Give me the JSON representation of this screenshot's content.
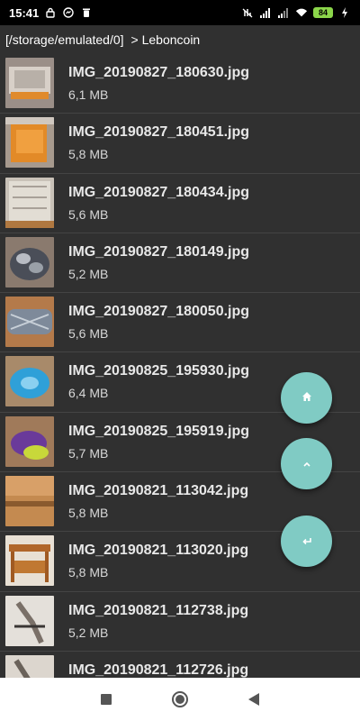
{
  "status_bar": {
    "time": "15:41",
    "battery": "84",
    "icons": [
      "lock-icon",
      "messenger-icon",
      "trash-icon",
      "data-off-icon",
      "signal-icon",
      "signal-icon",
      "wifi-icon",
      "battery-icon",
      "charging-icon"
    ]
  },
  "path": {
    "root": "[/storage/emulated/0]",
    "current": "> Leboncoin"
  },
  "files": [
    {
      "name": "IMG_20190827_180630.jpg",
      "size": "6,1 MB"
    },
    {
      "name": "IMG_20190827_180451.jpg",
      "size": "5,8 MB"
    },
    {
      "name": "IMG_20190827_180434.jpg",
      "size": "5,6 MB"
    },
    {
      "name": "IMG_20190827_180149.jpg",
      "size": "5,2 MB"
    },
    {
      "name": "IMG_20190827_180050.jpg",
      "size": "5,6 MB"
    },
    {
      "name": "IMG_20190825_195930.jpg",
      "size": "6,4 MB"
    },
    {
      "name": "IMG_20190825_195919.jpg",
      "size": "5,7 MB"
    },
    {
      "name": "IMG_20190821_113042.jpg",
      "size": "5,8 MB"
    },
    {
      "name": "IMG_20190821_113020.jpg",
      "size": "5,8 MB"
    },
    {
      "name": "IMG_20190821_112738.jpg",
      "size": "5,2 MB"
    },
    {
      "name": "IMG_20190821_112726.jpg",
      "size": ""
    }
  ],
  "fabs": [
    {
      "icon": "home-icon"
    },
    {
      "icon": "chevron-up-icon"
    },
    {
      "icon": "back-arrow-icon"
    }
  ],
  "nav": [
    "recents-square-icon",
    "home-circle-icon",
    "back-triangle-icon"
  ],
  "colors": {
    "background": "#303030",
    "divider": "#444444",
    "fab": "#80cbc4",
    "battery": "#8bd64a",
    "status_bar": "#000000",
    "nav_bar": "#ffffff"
  }
}
